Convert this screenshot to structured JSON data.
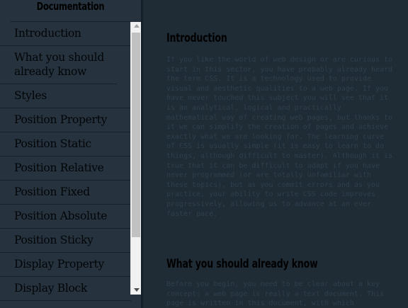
{
  "sidebar": {
    "title": "Documentation",
    "items": [
      {
        "label": "Introduction"
      },
      {
        "label": "What you should already know"
      },
      {
        "label": "Styles"
      },
      {
        "label": "Position Property"
      },
      {
        "label": "Position Static"
      },
      {
        "label": "Position Relative"
      },
      {
        "label": "Position Fixed"
      },
      {
        "label": "Position Absolute"
      },
      {
        "label": "Position Sticky"
      },
      {
        "label": "Display Property"
      },
      {
        "label": "Display Block"
      }
    ]
  },
  "main": {
    "sections": [
      {
        "title": "Introduction",
        "text": "If you like the world of web design or are curious to start in this sector, you have probably already heard the term CSS. It is a technology used to provide visual and aesthetic qualities to a web page. If you have never touched this subject you will see that it is an analytical, logical and practically mathematical way of creating web pages, but thanks to it we can simplify the creation of pages and achieve exactly what we are looking for. The learning curve of CSS is usually simple (it is easy to learn to do things, although difficult to master). Although it is true that it can be difficult to adapt if you have never programmed (or are totally unfamiliar with these topics), but as you commit errors and as you practice, your ability to write CSS code improves progressively, allowing us to advance at an ever faster pace."
      },
      {
        "title": "What you should already know",
        "text": "Before you begin, you need to be clear about a key concept: a web page is really a text document. This page is written in this document, with which"
      }
    ]
  },
  "colors": {
    "content_background": "#1f2b35",
    "sidebar_background": "#26323d",
    "divider": "#15202a",
    "body_text": "#2e3f4d",
    "heading_text": "#000000",
    "scrollbar_track": "#f1f1f1",
    "scrollbar_thumb": "#c1c1c1"
  },
  "icons": {
    "scroll_up": "scroll-up-arrow-icon",
    "scroll_down": "scroll-down-arrow-icon"
  }
}
